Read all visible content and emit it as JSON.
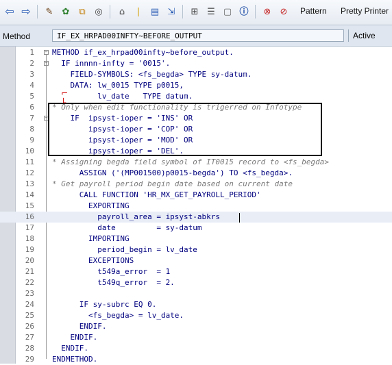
{
  "toolbar": {
    "pattern_label": "Pattern",
    "pretty_printer_label": "Pretty Printer",
    "icons": [
      "back-arrow-icon",
      "forward-arrow-icon",
      "check-syntax-icon",
      "activate-icon",
      "where-used-icon",
      "display-object-list-icon",
      "navigate-icon",
      "breakpoint-icon",
      "fullscreen-icon",
      "transfer-icon",
      "structure-icon",
      "column-icon",
      "grid-icon",
      "info-icon",
      "delete-icon",
      "comment-icon"
    ]
  },
  "method_row": {
    "label": "Method",
    "value": "IF_EX_HRPAD00INFTY~BEFORE_OUTPUT",
    "status": "Active"
  },
  "editor": {
    "lines": [
      {
        "n": "1",
        "text": "METHOD if_ex_hrpad00infty~before_output.",
        "type": "code"
      },
      {
        "n": "2",
        "text": "  IF innnn-infty = '0015'.",
        "type": "code"
      },
      {
        "n": "3",
        "text": "    FIELD-SYMBOLS: <fs_begda> TYPE sy-datum.",
        "type": "code"
      },
      {
        "n": "4",
        "text": "    DATA: lw_0015 TYPE p0015,",
        "type": "code"
      },
      {
        "n": "5",
        "text": "          lv_date   TYPE datum.",
        "type": "code"
      },
      {
        "n": "6",
        "text": "* Only when edit functionality is trigerred on Infotype",
        "type": "comment"
      },
      {
        "n": "7",
        "text": "    IF  ipsyst-ioper = 'INS' OR",
        "type": "code"
      },
      {
        "n": "8",
        "text": "        ipsyst-ioper = 'COP' OR",
        "type": "code"
      },
      {
        "n": "9",
        "text": "        ipsyst-ioper = 'MOD' OR",
        "type": "code"
      },
      {
        "n": "10",
        "text": "        ipsyst-ioper = 'DEL'.",
        "type": "code"
      },
      {
        "n": "11",
        "text": "* Assigning begda field symbol of IT0015 record to <fs_begda>",
        "type": "comment"
      },
      {
        "n": "12",
        "text": "      ASSIGN ('(MP001500)p0015-begda') TO <fs_begda>.",
        "type": "code"
      },
      {
        "n": "13",
        "text": "* Get payroll period begin date based on current date",
        "type": "comment"
      },
      {
        "n": "14",
        "text": "      CALL FUNCTION 'HR_MX_GET_PAYROLL_PERIOD'",
        "type": "code"
      },
      {
        "n": "15",
        "text": "        EXPORTING",
        "type": "code"
      },
      {
        "n": "16",
        "text": "          payroll_area = ipsyst-abkrs",
        "type": "code"
      },
      {
        "n": "17",
        "text": "          date         = sy-datum",
        "type": "code"
      },
      {
        "n": "18",
        "text": "        IMPORTING",
        "type": "code"
      },
      {
        "n": "19",
        "text": "          period_begin = lv_date",
        "type": "code"
      },
      {
        "n": "20",
        "text": "        EXCEPTIONS",
        "type": "code"
      },
      {
        "n": "21",
        "text": "          t549a_error  = 1",
        "type": "code"
      },
      {
        "n": "22",
        "text": "          t549q_error  = 2.",
        "type": "code"
      },
      {
        "n": "23",
        "text": "",
        "type": "code"
      },
      {
        "n": "24",
        "text": "      IF sy-subrc EQ 0.",
        "type": "code"
      },
      {
        "n": "25",
        "text": "        <fs_begda> = lv_date.",
        "type": "code"
      },
      {
        "n": "26",
        "text": "      ENDIF.",
        "type": "code"
      },
      {
        "n": "27",
        "text": "    ENDIF.",
        "type": "code"
      },
      {
        "n": "28",
        "text": "  ENDIF.",
        "type": "code"
      },
      {
        "n": "29",
        "text": "ENDMETHOD.",
        "type": "code"
      }
    ]
  }
}
